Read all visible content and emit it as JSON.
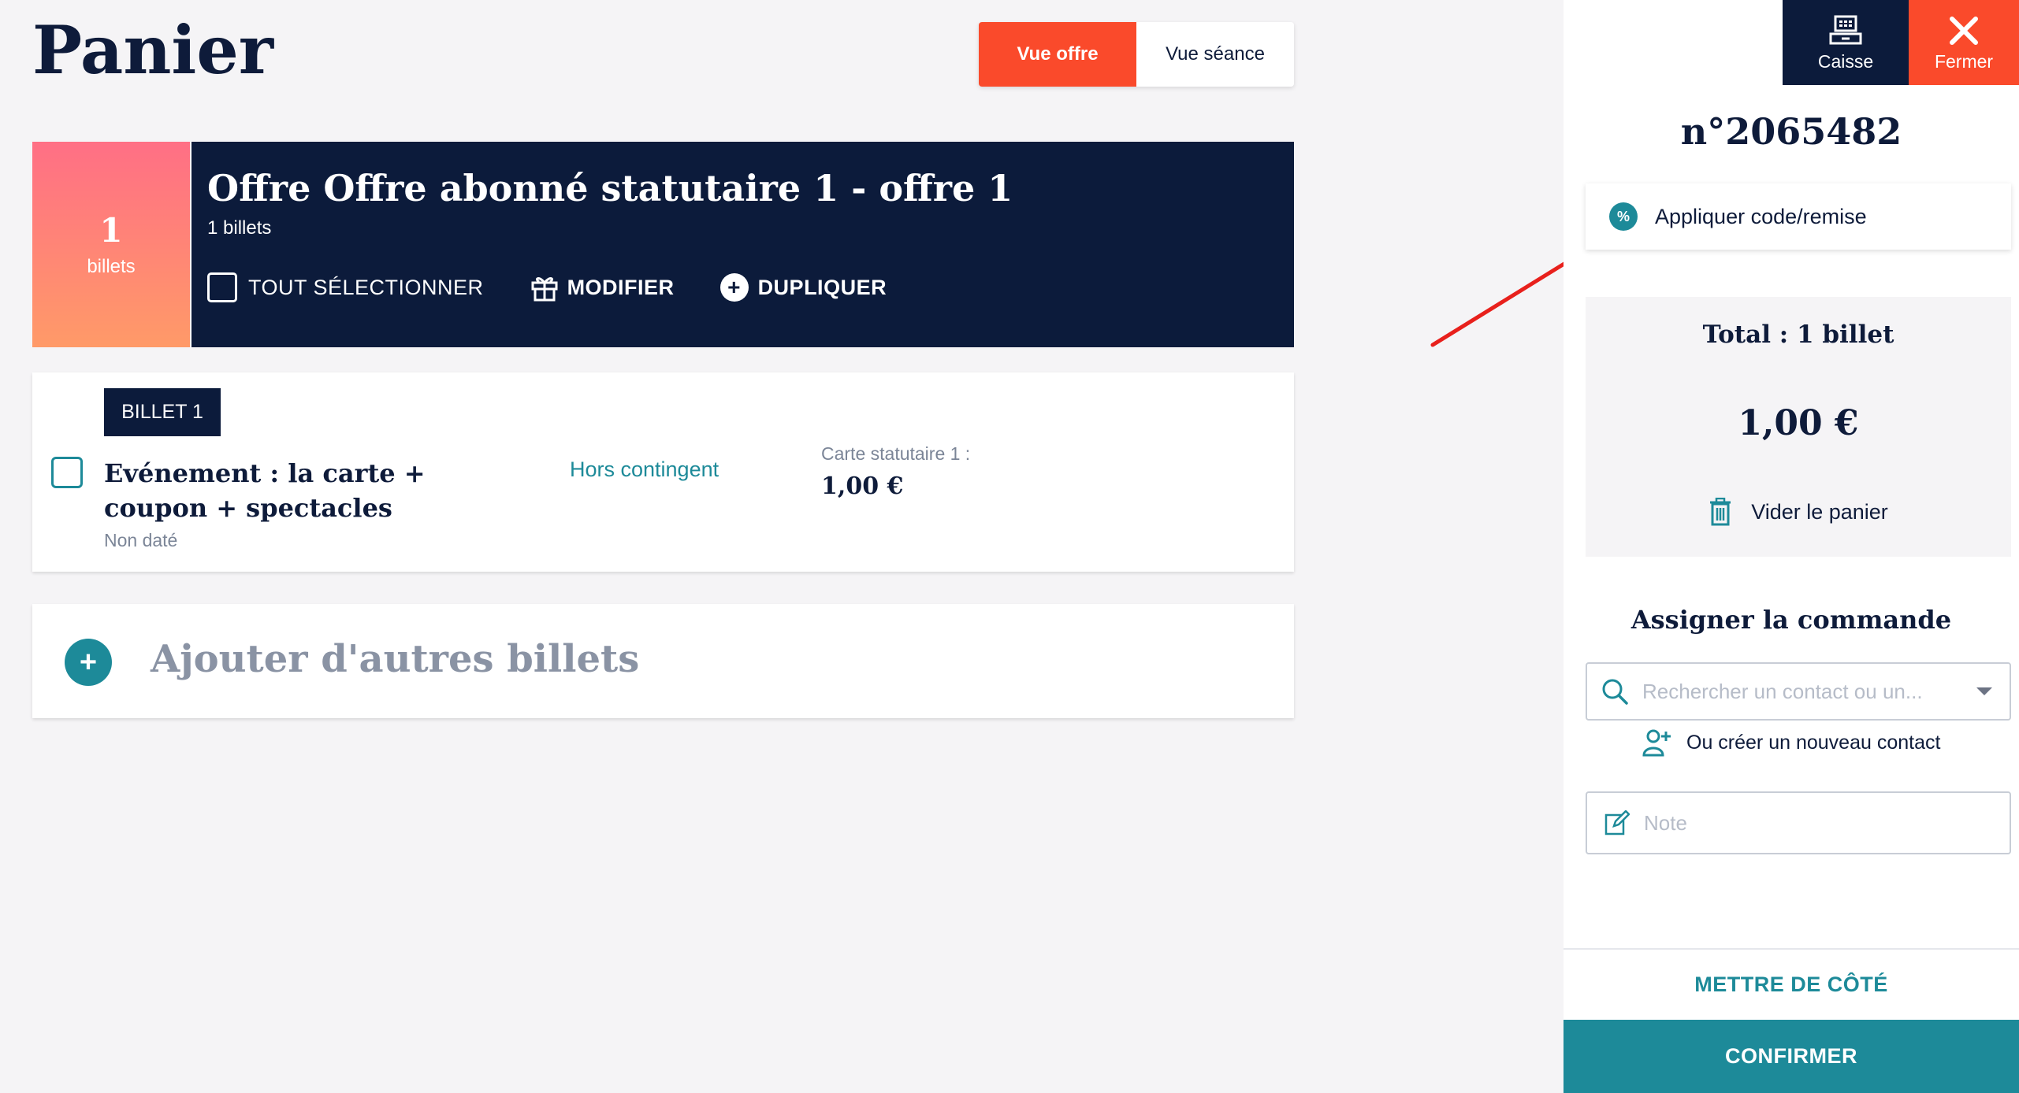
{
  "page": {
    "title": "Panier"
  },
  "view_toggle": {
    "active": "Vue offre",
    "inactive": "Vue séance"
  },
  "offer": {
    "count": "1",
    "count_label": "billets",
    "title": "Offre Offre abonné statutaire 1 - offre 1",
    "subtitle": "1 billets",
    "actions": {
      "select_all": "TOUT SÉLECTIONNER",
      "modify": "MODIFIER",
      "duplicate": "DUPLIQUER"
    }
  },
  "ticket": {
    "badge": "BILLET 1",
    "event_name": "Evénement : la carte + coupon + spectacles",
    "event_date": "Non daté",
    "quota": "Hors contingent",
    "price_label": "Carte statutaire 1 :",
    "price": "1,00 €"
  },
  "add_tickets": {
    "label": "Ajouter d'autres billets"
  },
  "sidebar": {
    "caisse_label": "Caisse",
    "close_label": "Fermer",
    "order_number": "n°2065482",
    "apply_code": "Appliquer code/remise",
    "total_title": "Total : 1 billet",
    "total_amount": "1,00 €",
    "empty_cart": "Vider le panier",
    "assign_title": "Assigner la commande",
    "search_placeholder": "Rechercher un contact ou un...",
    "new_contact": "Ou créer un nouveau contact",
    "note_placeholder": "Note",
    "put_aside": "METTRE DE CÔTÉ",
    "confirm": "CONFIRMER"
  },
  "colors": {
    "primary_navy": "#0c1b3b",
    "accent_orange": "#fa4a2b",
    "teal": "#1d8a99",
    "annotation_arrow": "#e8201c"
  }
}
